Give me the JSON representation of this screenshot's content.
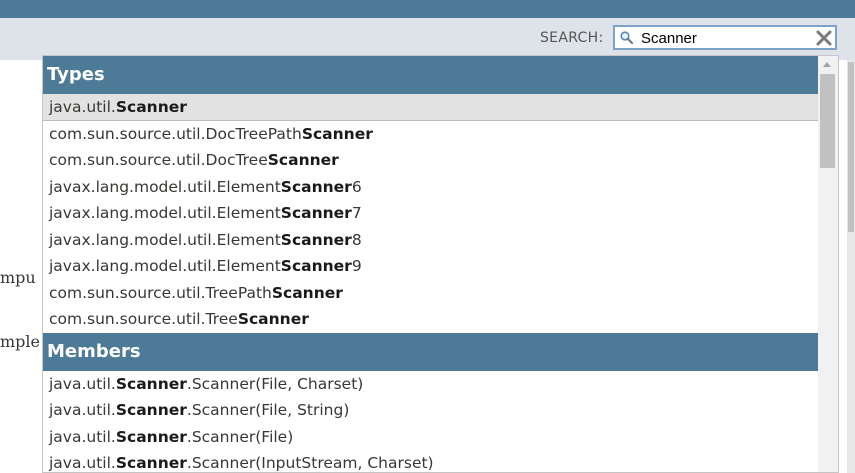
{
  "search": {
    "label": "SEARCH:",
    "value": "Scanner"
  },
  "background_text": [
    {
      "text": "mpu"
    },
    {
      "text": "mple"
    }
  ],
  "dropdown": {
    "types_header": "Types",
    "types": [
      {
        "prefix": "java.util.",
        "match": "Scanner",
        "suffix": ""
      },
      {
        "prefix": "com.sun.source.util.DocTreePath",
        "match": "Scanner",
        "suffix": ""
      },
      {
        "prefix": "com.sun.source.util.DocTree",
        "match": "Scanner",
        "suffix": ""
      },
      {
        "prefix": "javax.lang.model.util.Element",
        "match": "Scanner",
        "suffix": "6"
      },
      {
        "prefix": "javax.lang.model.util.Element",
        "match": "Scanner",
        "suffix": "7"
      },
      {
        "prefix": "javax.lang.model.util.Element",
        "match": "Scanner",
        "suffix": "8"
      },
      {
        "prefix": "javax.lang.model.util.Element",
        "match": "Scanner",
        "suffix": "9"
      },
      {
        "prefix": "com.sun.source.util.TreePath",
        "match": "Scanner",
        "suffix": ""
      },
      {
        "prefix": "com.sun.source.util.Tree",
        "match": "Scanner",
        "suffix": ""
      }
    ],
    "members_header": "Members",
    "members": [
      {
        "prefix": "java.util.",
        "match": "Scanner",
        "suffix": ".Scanner(File, Charset)"
      },
      {
        "prefix": "java.util.",
        "match": "Scanner",
        "suffix": ".Scanner(File, String)"
      },
      {
        "prefix": "java.util.",
        "match": "Scanner",
        "suffix": ".Scanner(File)"
      },
      {
        "prefix": "java.util.",
        "match": "Scanner",
        "suffix": ".Scanner(InputStream, Charset)"
      }
    ]
  },
  "colors": {
    "header": "#4d7a97",
    "subbar": "#dee3e9",
    "search_border": "#7ea3c8",
    "active_row": "#e2e2e2"
  }
}
